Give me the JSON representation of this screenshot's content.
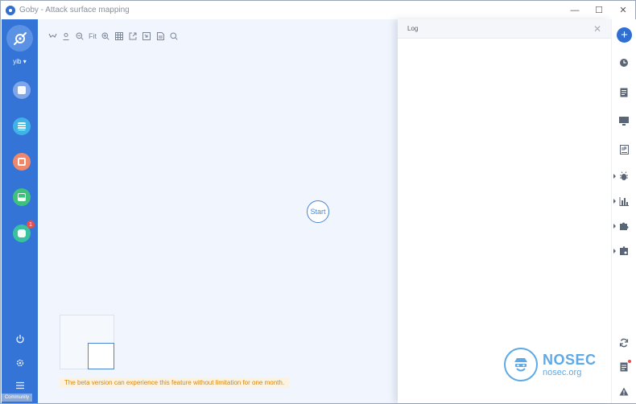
{
  "window": {
    "title": "Goby - Attack surface mapping",
    "controls": [
      "—",
      "☐",
      "✕"
    ]
  },
  "sidebar": {
    "user": "yib",
    "items": [
      {
        "icon": "asset-icon",
        "color": "#7fa6e8"
      },
      {
        "icon": "list-icon",
        "color": "#3fb3e6"
      },
      {
        "icon": "vuln-icon",
        "color": "#f0866a"
      },
      {
        "icon": "chart-icon",
        "color": "#3ec17c"
      },
      {
        "icon": "plugin-icon",
        "color": "#39c2a0",
        "badge": "1"
      }
    ],
    "community_label": "Community"
  },
  "toolbar": {
    "fit_label": "Fit"
  },
  "canvas": {
    "start_label": "Start",
    "beta_notice": "The beta version can experience this feature without limitation for one month."
  },
  "log_panel": {
    "title": "Log",
    "brand_name": "NOSEC",
    "brand_site": "nosec.org"
  },
  "colors": {
    "accent": "#2f6fd1",
    "sidebar": "#3474d6",
    "canvas_bg": "#f1f5fd"
  }
}
